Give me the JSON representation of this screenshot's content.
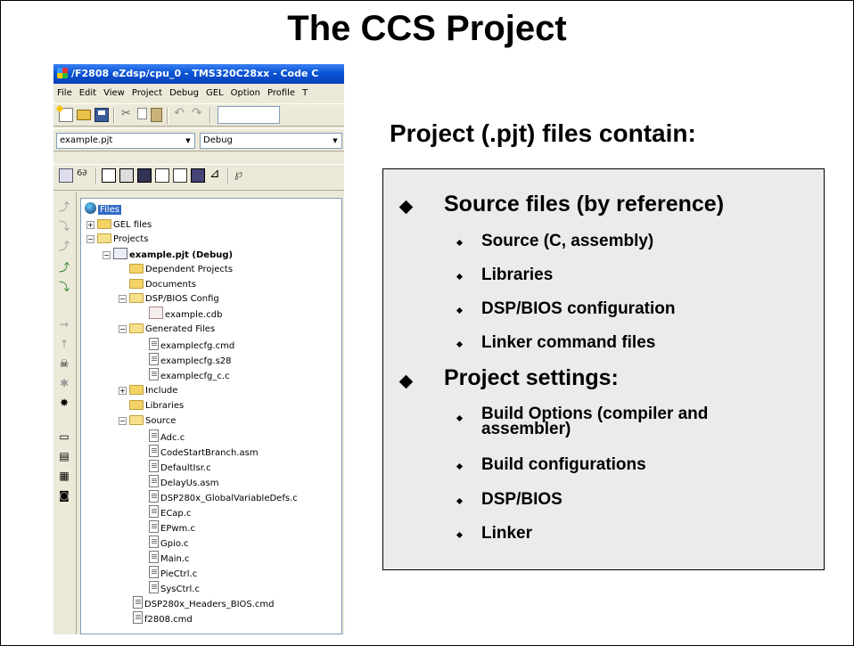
{
  "slide": {
    "title": "The CCS Project"
  },
  "ccs_window": {
    "title": "/F2808 eZdsp/cpu_0 - TMS320C28xx - Code C",
    "menu": [
      "File",
      "Edit",
      "View",
      "Project",
      "Debug",
      "GEL",
      "Option",
      "Profile",
      "T"
    ],
    "project_combo": "example.pjt",
    "config_combo": "Debug",
    "tree": {
      "root": "Files",
      "gel_files": "GEL files",
      "projects": "Projects",
      "project": "example.pjt (Debug)",
      "dependent_projects": "Dependent Projects",
      "documents": "Documents",
      "dspbios_config": "DSP/BIOS Config",
      "cdb_file": "example.cdb",
      "generated_files": "Generated Files",
      "generated": [
        "examplecfg.cmd",
        "examplecfg.s28",
        "examplecfg_c.c"
      ],
      "include": "Include",
      "libraries": "Libraries",
      "source": "Source",
      "source_files": [
        "Adc.c",
        "CodeStartBranch.asm",
        "DefaultIsr.c",
        "DelayUs.asm",
        "DSP280x_GlobalVariableDefs.c",
        "ECap.c",
        "EPwm.c",
        "Gpio.c",
        "Main.c",
        "PieCtrl.c",
        "SysCtrl.c"
      ],
      "top_files": [
        "DSP280x_Headers_BIOS.cmd",
        "f2808.cmd"
      ]
    }
  },
  "content": {
    "heading": "Project (.pjt) files contain:",
    "sections": [
      {
        "label": "Source files (by reference)",
        "items": [
          "Source (C, assembly)",
          "Libraries",
          "DSP/BIOS configuration",
          "Linker command files"
        ]
      },
      {
        "label": "Project settings:",
        "items": [
          "Build Options (compiler and assembler)",
          "Build configurations",
          "DSP/BIOS",
          "Linker"
        ]
      }
    ]
  }
}
